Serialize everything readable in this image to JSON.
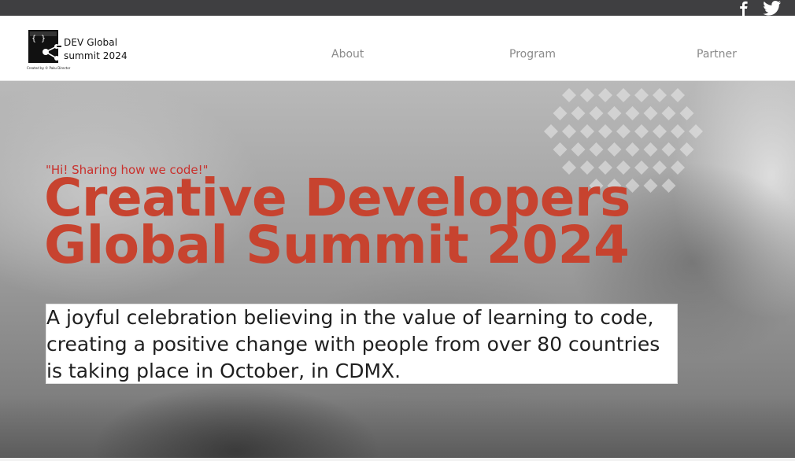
{
  "top_bar": {
    "social": [
      {
        "icon": "facebook-icon"
      },
      {
        "icon": "twitter-icon"
      }
    ]
  },
  "brand": {
    "line1": "DEV Global",
    "line2": "summit 2024",
    "credit": "Created by © Paku Director",
    "logo_glyph": "{ }"
  },
  "nav": {
    "items": [
      {
        "label": "About"
      },
      {
        "label": "Program"
      },
      {
        "label": "Partner"
      }
    ]
  },
  "hero": {
    "tagline": "\"Hi! Sharing how we code!\"",
    "title_line1": "Creative Developers",
    "title_line2": "Global Summit 2024",
    "description": "A joyful celebration believing in the value of learning to code, creating a positive change with people from over 80 countries is taking place in October, in CDMX."
  },
  "colors": {
    "accent": "#c7432f",
    "top_bar": "#3f3f41",
    "nav_text": "#8a8a8a"
  }
}
